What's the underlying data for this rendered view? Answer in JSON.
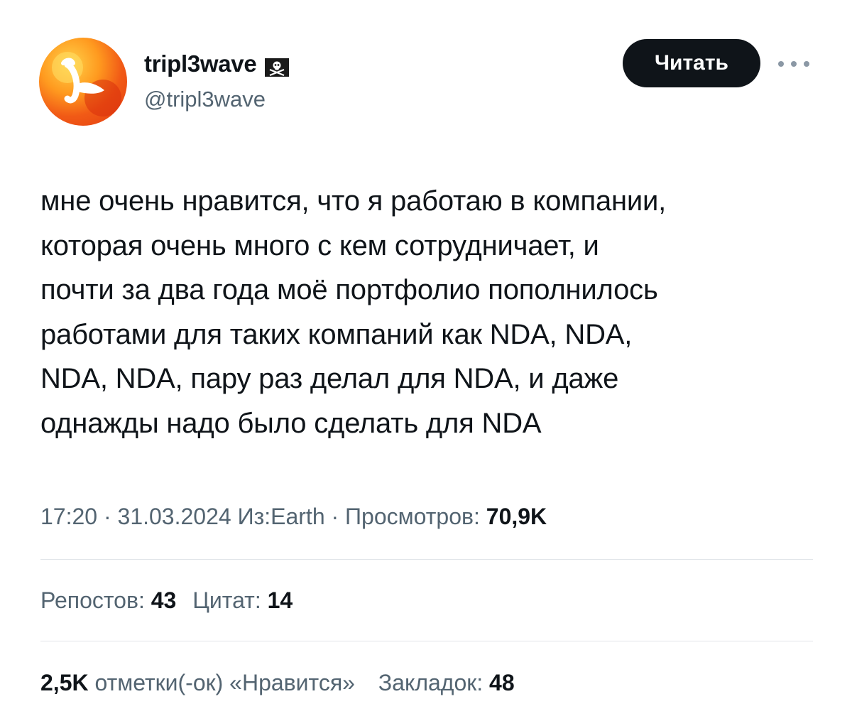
{
  "user": {
    "display_name": "tripl3wave",
    "handle": "@tripl3wave",
    "badge_icon": "pirate-flag-icon"
  },
  "actions": {
    "follow_label": "Читать",
    "more_icon": "more-icon"
  },
  "tweet": {
    "lines": [
      "мне очень нравится, что я работаю в компании,",
      "которая очень много с кем сотрудничает, и",
      "почти за два года моё портфолио пополнилось",
      "работами для таких компаний как NDA, NDA,",
      "NDA, NDA, пару раз делал для NDA, и даже",
      "однажды надо было сделать для NDA"
    ]
  },
  "meta": {
    "time": "17:20",
    "separator": " · ",
    "date": "31.03.2024",
    "source": "Из:Earth",
    "views_label": "Просмотров: ",
    "views_count": "70,9K"
  },
  "stats": {
    "reposts_label": "Репостов: ",
    "reposts_count": "43",
    "quotes_label": "Цитат: ",
    "quotes_count": "14",
    "likes_count": "2,5K",
    "likes_label": " отметки(-ок) «Нравится»",
    "bookmarks_label": "Закладок: ",
    "bookmarks_count": "48"
  }
}
